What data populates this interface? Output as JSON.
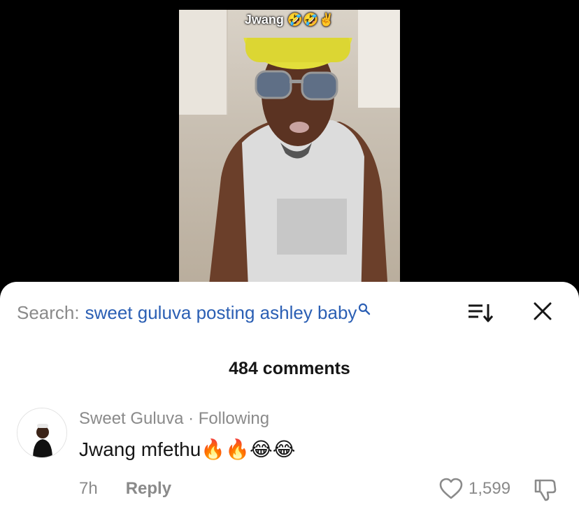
{
  "video": {
    "caption": "Jwang 🤣🤣✌️"
  },
  "search": {
    "label": "Search:",
    "query": "sweet guluva posting ashley baby"
  },
  "comments_header": {
    "count_text": "484 comments"
  },
  "comment": {
    "author": "Sweet Guluva",
    "separator": " · ",
    "relation": "Following",
    "text": "Jwang mfethu🔥🔥😂😂",
    "time": "7h",
    "reply_label": "Reply",
    "like_count": "1,599"
  },
  "colors": {
    "search_query": "#2b5fb4",
    "muted": "#8a8a8a",
    "text": "#161616",
    "sheet_bg": "#ffffff",
    "backdrop": "#000000"
  },
  "icons": {
    "search": "magnifier-icon",
    "sort": "sort-icon",
    "close": "close-icon",
    "like": "heart-icon",
    "dislike": "thumbs-down-icon"
  }
}
